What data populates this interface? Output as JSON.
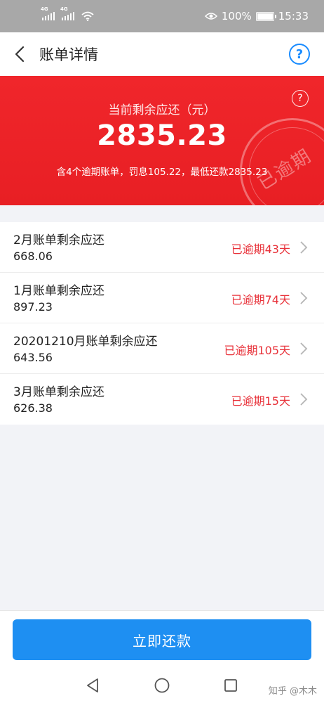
{
  "status_bar": {
    "sim1": "4G",
    "sim2": "4G",
    "battery": "100%",
    "time": "15:33"
  },
  "nav": {
    "title": "账单详情",
    "help_symbol": "?"
  },
  "hero": {
    "help_symbol": "?",
    "label": "当前剩余应还（元）",
    "amount": "2835.23",
    "description": "含4个逾期账单，罚息105.22，最低还款2835.23",
    "stamp_text": "已逾期"
  },
  "bills": [
    {
      "title": "2月账单剩余应还",
      "amount": "668.06",
      "status": "已逾期43天"
    },
    {
      "title": "1月账单剩余应还",
      "amount": "897.23",
      "status": "已逾期74天"
    },
    {
      "title": "20201210月账单剩余应还",
      "amount": "643.56",
      "status": "已逾期105天"
    },
    {
      "title": "3月账单剩余应还",
      "amount": "626.38",
      "status": "已逾期15天"
    }
  ],
  "actions": {
    "pay_now": "立即还款"
  },
  "watermark": "知乎 @木木",
  "colors": {
    "accent_red": "#e81f24",
    "overdue_text": "#e8323a",
    "primary_blue": "#1e8ff2"
  }
}
